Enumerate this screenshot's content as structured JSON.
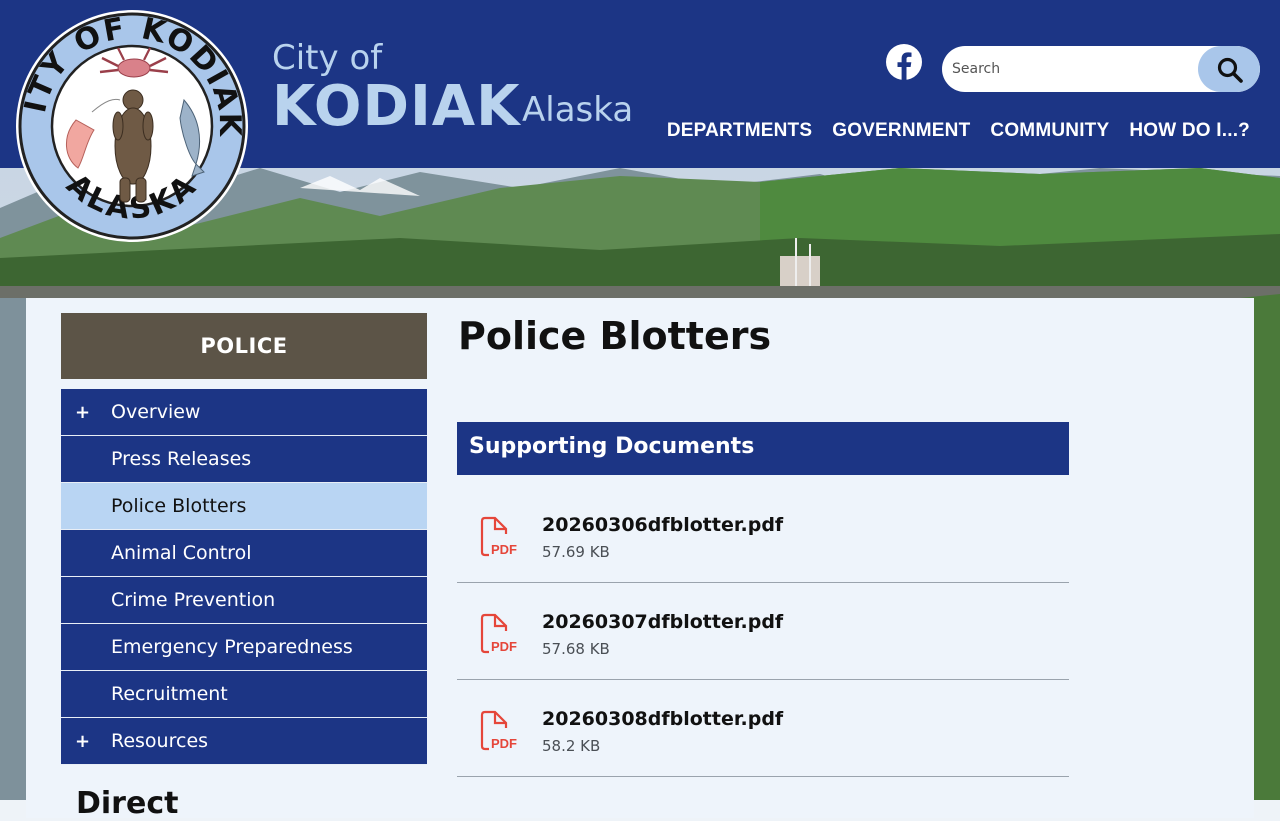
{
  "colors": {
    "header_bg": "#1c3585",
    "brand_text": "#b9d3ee",
    "side_title_bg": "#5c5447",
    "nav_item_bg": "#1c3585",
    "nav_item_active_bg": "#b9d5f3",
    "pdf_icon": "#e5463a",
    "panel_bg": "#eef4fb"
  },
  "seal": {
    "top_text": "CITY OF KODIAK",
    "bottom_text": "ALASKA"
  },
  "brand": {
    "city_of": "City of",
    "name": "KODIAK",
    "state": "Alaska"
  },
  "header": {
    "social_icon": "facebook-icon",
    "search": {
      "placeholder": "Search",
      "icon": "search-icon"
    },
    "nav": [
      "DEPARTMENTS",
      "GOVERNMENT",
      "COMMUNITY",
      "HOW DO I...?"
    ]
  },
  "sidebar": {
    "title": "POLICE",
    "items": [
      {
        "label": "Overview",
        "prefix": "+",
        "active": false
      },
      {
        "label": "Press Releases",
        "prefix": "",
        "active": false
      },
      {
        "label": "Police Blotters",
        "prefix": "",
        "active": true
      },
      {
        "label": "Animal Control",
        "prefix": "",
        "active": false
      },
      {
        "label": "Crime Prevention",
        "prefix": "",
        "active": false
      },
      {
        "label": "Emergency Preparedness",
        "prefix": "",
        "active": false
      },
      {
        "label": "Recruitment",
        "prefix": "",
        "active": false
      },
      {
        "label": "Resources",
        "prefix": "+",
        "active": false
      }
    ],
    "directory_heading": "Direct"
  },
  "main": {
    "page_title": "Police Blotters",
    "docs_heading": "Supporting Documents",
    "documents": [
      {
        "name": "20260306dfblotter.pdf",
        "size": "57.69 KB",
        "icon": "pdf-file-icon",
        "icon_text": "PDF"
      },
      {
        "name": "20260307dfblotter.pdf",
        "size": "57.68 KB",
        "icon": "pdf-file-icon",
        "icon_text": "PDF"
      },
      {
        "name": "20260308dfblotter.pdf",
        "size": "58.2 KB",
        "icon": "pdf-file-icon",
        "icon_text": "PDF"
      }
    ]
  }
}
